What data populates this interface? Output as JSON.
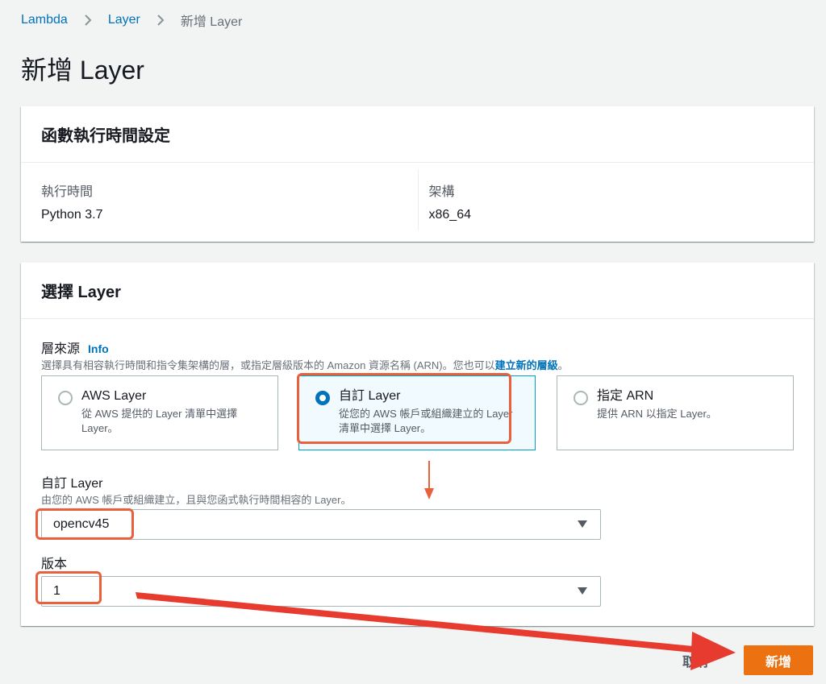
{
  "breadcrumb": {
    "items": [
      "Lambda",
      "Layer",
      "新增 Layer"
    ]
  },
  "page_title": "新增 Layer",
  "runtime_panel": {
    "title": "函數執行時間設定",
    "runtime_label": "執行時間",
    "runtime_value": "Python 3.7",
    "arch_label": "架構",
    "arch_value": "x86_64"
  },
  "layer_panel": {
    "title": "選擇 Layer",
    "source_label": "層來源",
    "info_link": "Info",
    "source_desc": "選擇具有相容執行時間和指令集架構的層，或指定層級版本的 Amazon 資源名稱 (ARN)。您也可以",
    "source_desc_link": "建立新的層級",
    "source_desc_end": "。",
    "options": [
      {
        "title": "AWS Layer",
        "desc": "從 AWS 提供的 Layer 清單中選擇 Layer。",
        "selected": false
      },
      {
        "title": "自訂 Layer",
        "desc": "從您的 AWS 帳戶或組織建立的 Layer 清單中選擇 Layer。",
        "selected": true
      },
      {
        "title": "指定 ARN",
        "desc": "提供 ARN 以指定 Layer。",
        "selected": false
      }
    ],
    "custom_layer_label": "自訂 Layer",
    "custom_layer_desc": "由您的 AWS 帳戶或組織建立，且與您函式執行時間相容的 Layer。",
    "custom_layer_value": "opencv45",
    "version_label": "版本",
    "version_value": "1"
  },
  "footer": {
    "cancel_label": "取消",
    "create_label": "新增"
  },
  "colors": {
    "link": "#0073bb",
    "primary_button": "#ec7211",
    "annotation": "#e8603c"
  }
}
